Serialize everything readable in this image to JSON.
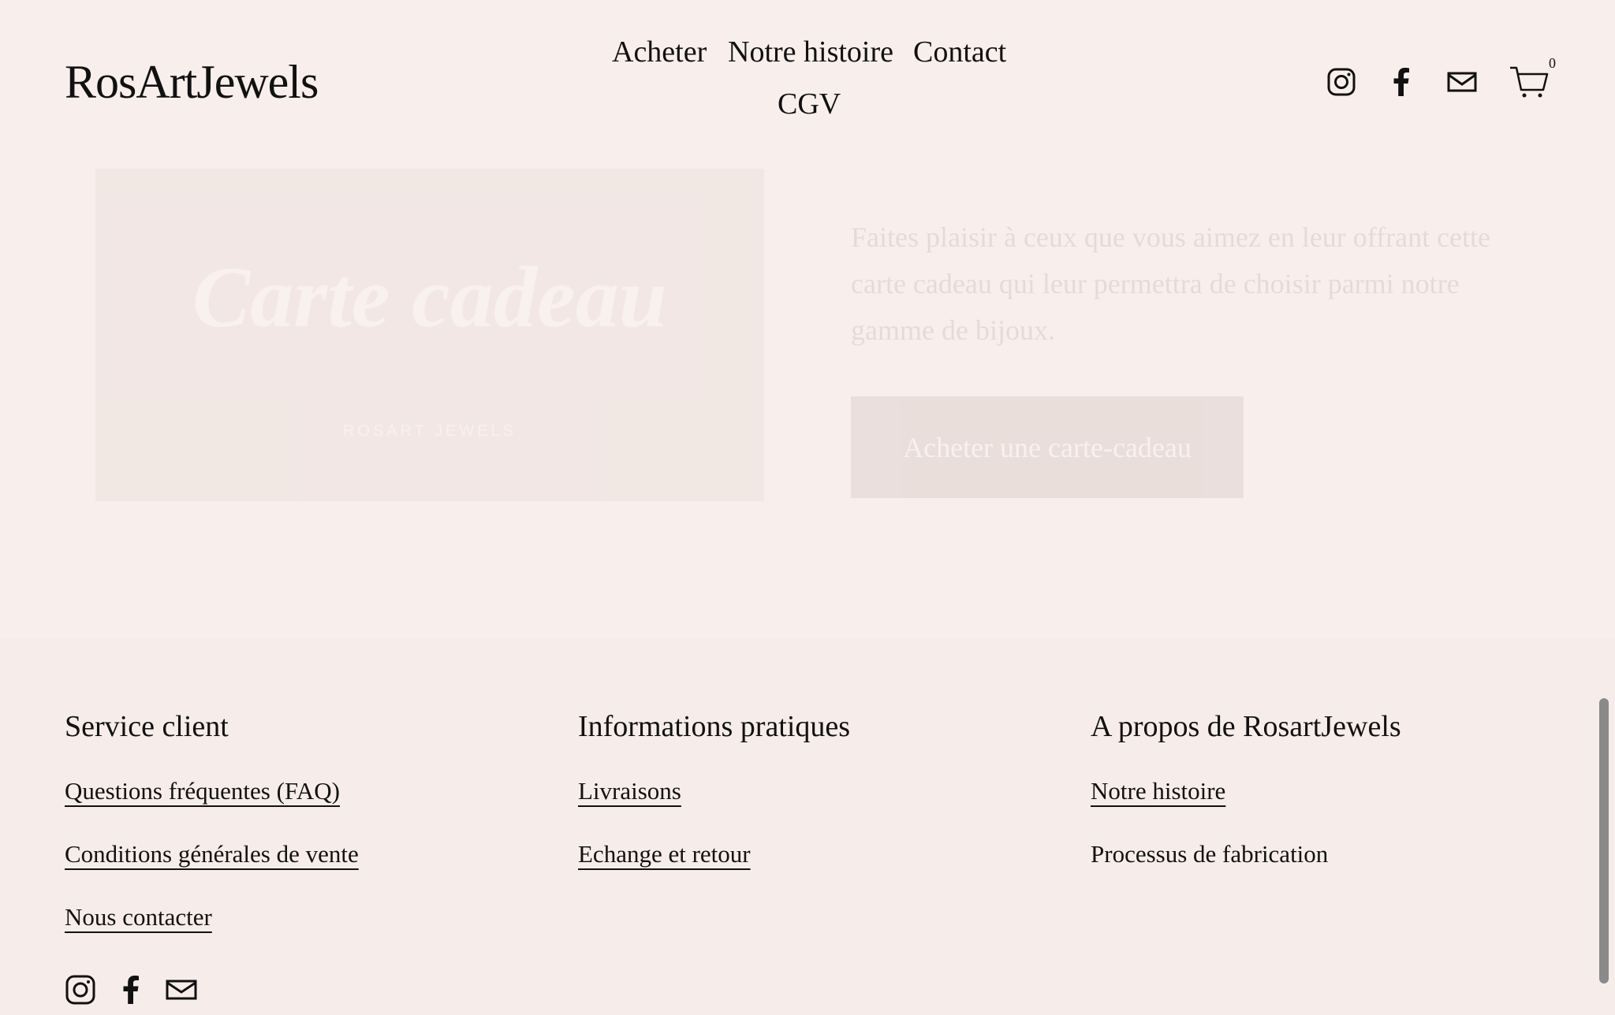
{
  "header": {
    "logo": "RosArtJewels",
    "nav": {
      "acheter": "Acheter",
      "histoire": "Notre histoire",
      "contact": "Contact",
      "cgv": "CGV"
    },
    "cart_count": "0",
    "icons": [
      "instagram-icon",
      "facebook-icon",
      "mail-icon",
      "cart-icon"
    ]
  },
  "gift": {
    "card_title": "Carte cadeau",
    "card_brand": "ROSART JEWELS",
    "description": "Faites plaisir à ceux que vous aimez en leur offrant cette carte cadeau qui leur permettra de choisir parmi notre gamme de bijoux.",
    "button_label": "Acheter une carte-cadeau"
  },
  "footer": {
    "service": {
      "heading": "Service client",
      "faq": "Questions fréquentes (FAQ)",
      "cgv": "Conditions générales de vente",
      "contact": "Nous contacter"
    },
    "infos": {
      "heading": "Informations pratiques",
      "livraisons": "Livraisons",
      "echange": "Echange et retour"
    },
    "about": {
      "heading": "A propos de RosartJewels",
      "histoire": "Notre histoire",
      "processus": "Processus de fabrication"
    },
    "icons": [
      "instagram-icon",
      "facebook-icon",
      "mail-icon"
    ]
  },
  "colors": {
    "background": "#f8efec",
    "text": "#111111",
    "button": "#8b6e69"
  }
}
